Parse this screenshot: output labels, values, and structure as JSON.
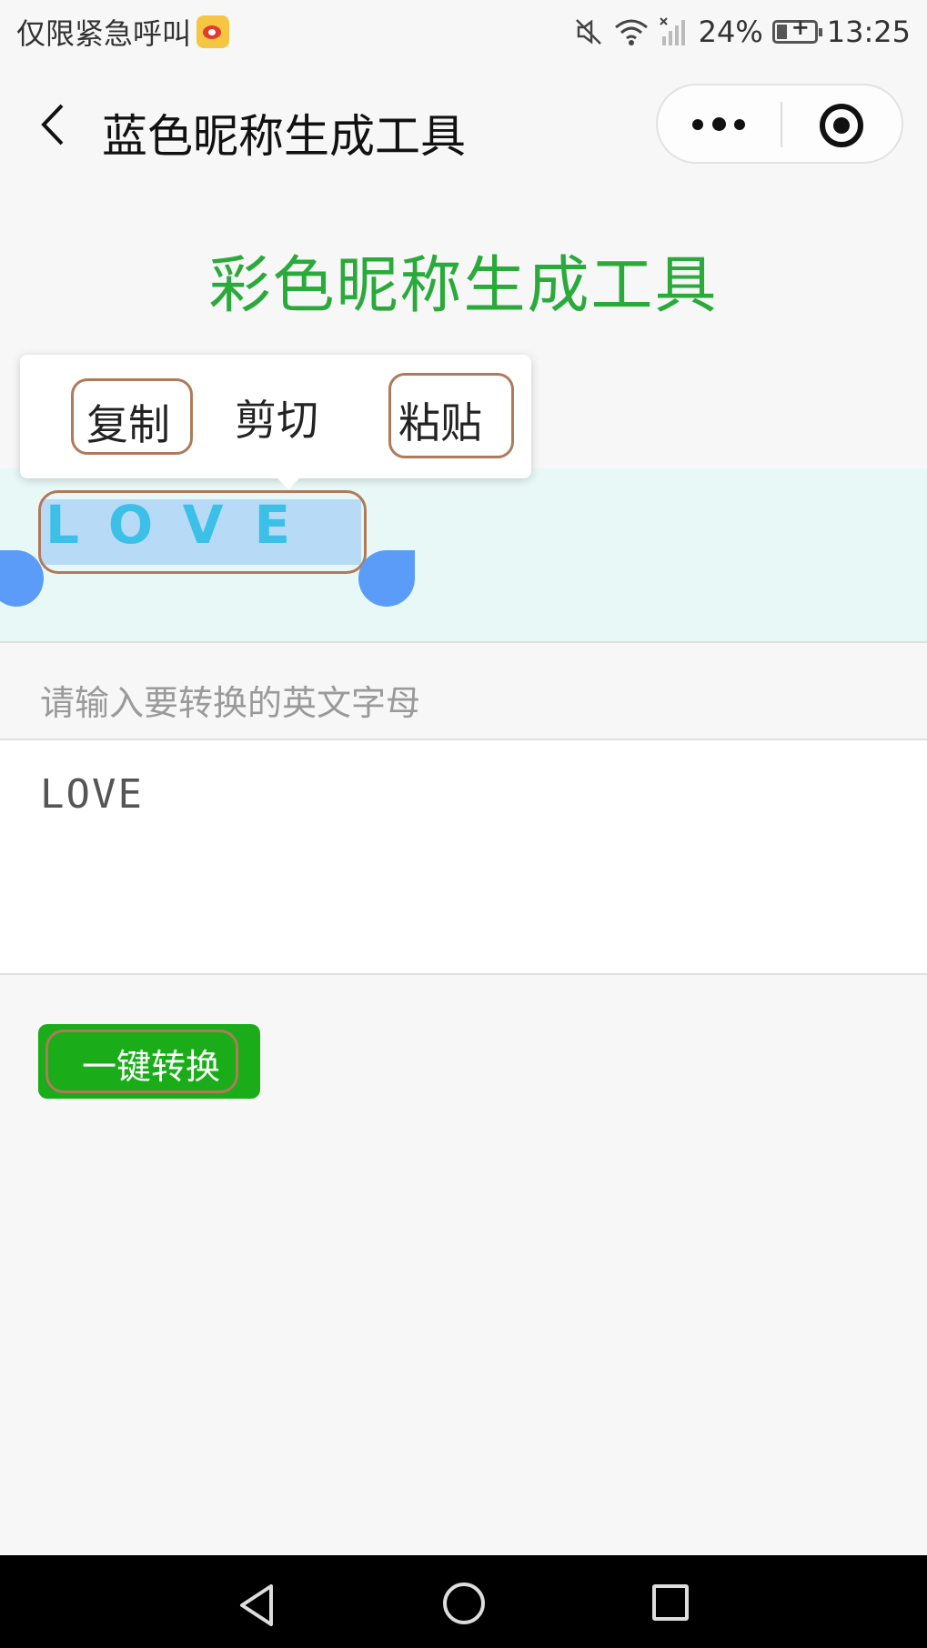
{
  "status_bar": {
    "carrier": "仅限紧急呼叫",
    "battery": "24%",
    "time": "13:25"
  },
  "nav": {
    "title": "蓝色昵称生成工具"
  },
  "page": {
    "heading": "彩色昵称生成工具"
  },
  "context_menu": {
    "copy": "复制",
    "cut": "剪切",
    "paste": "粘贴"
  },
  "result": {
    "text": "LOVE",
    "text_color": "#3cc0e8",
    "selection_color": "#b7dbf7"
  },
  "input": {
    "label": "请输入要转换的英文字母",
    "value": "LOVE"
  },
  "convert_button": {
    "label": "一键转换",
    "color": "#1aad19"
  },
  "colors": {
    "heading": "#2aaa3a",
    "result_bg": "#e8f8f6",
    "annotation_outline": "#b07a5a",
    "selection_handle": "#5a9cf7"
  }
}
